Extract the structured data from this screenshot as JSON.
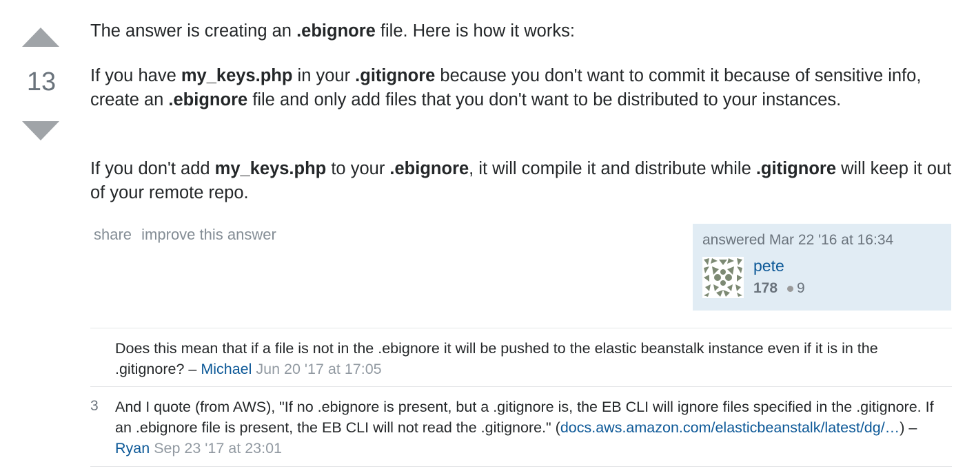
{
  "vote": {
    "count": "13",
    "up_icon": "triangle-up-icon",
    "down_icon": "triangle-down-icon"
  },
  "answer": {
    "p1": {
      "t1": "The answer is creating an ",
      "b1": ".ebignore",
      "t2": " file. Here is how it works:"
    },
    "p2": {
      "t1": "If you have ",
      "b1": "my_keys.php",
      "t2": " in your ",
      "b2": ".gitignore",
      "t3": " because you don't want to commit it because of sensitive info, create an ",
      "b3": ".ebignore",
      "t4": " file and only add files that you don't want to be distributed to your instances."
    },
    "p3": {
      "t1": "If you don't add ",
      "b1": "my_keys.php",
      "t2": " to your ",
      "b2": ".ebignore",
      "t3": ", it will compile it and distribute while ",
      "b3": ".gitignore",
      "t4": " will keep it out of your remote repo."
    }
  },
  "post_menu": {
    "share_label": "share",
    "improve_label": "improve this answer"
  },
  "user_card": {
    "action": "answered Mar 22 '16 at 16:34",
    "name": "pete",
    "reputation": "178",
    "bronze_badges": "9"
  },
  "comments": [
    {
      "score": "",
      "text": "Does this mean that if a file is not in the .ebignore it will be pushed to the elastic beanstalk instance even if it is in the .gitignore? – ",
      "user": "Michael",
      "date": "Jun 20 '17 at 17:05"
    },
    {
      "score": "3",
      "text": "And I quote (from AWS), \"If no .ebignore is present, but a .gitignore is, the EB CLI will ignore files specified in the .gitignore. If an .ebignore file is present, the EB CLI will not read the .gitignore.\" (",
      "link": "docs.aws.amazon.com/elasticbeanstalk/latest/dg/…",
      "text_after": ") – ",
      "user": "Ryan",
      "date": "Sep 23 '17 at 23:01"
    }
  ]
}
